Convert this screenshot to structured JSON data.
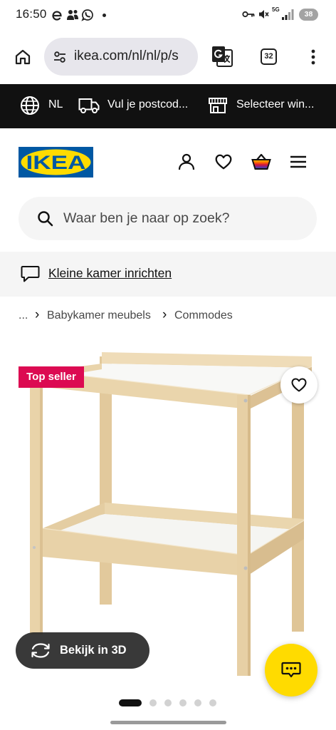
{
  "status_bar": {
    "time": "16:50",
    "network_type": "5G",
    "battery_level": "38",
    "left_icons": [
      "e-icon",
      "people-icon",
      "whatsapp-icon",
      "notification-dot-icon"
    ],
    "right_icons": [
      "key-icon",
      "mute-icon",
      "signal-icon",
      "battery-icon"
    ]
  },
  "browser": {
    "url": "ikea.com/nl/nl/p/s",
    "tab_count": "32",
    "icons": [
      "home-icon",
      "tune-icon",
      "google-translate-icon",
      "more-vert-icon"
    ]
  },
  "utility_bar": {
    "language": {
      "icon": "globe-icon",
      "label": "NL"
    },
    "postcode": {
      "icon": "truck-icon",
      "label": "Vul je postcod..."
    },
    "store": {
      "icon": "store-icon",
      "label": "Selecteer win..."
    }
  },
  "header": {
    "logo_text": "IKEA",
    "icons": [
      "person-icon",
      "heart-icon",
      "basket-icon",
      "menu-icon"
    ]
  },
  "search": {
    "icon": "search-icon",
    "placeholder": "Waar ben je naar op zoek?"
  },
  "promo": {
    "icon": "chat-bubble-icon",
    "link_text": "Kleine kamer inrichten"
  },
  "breadcrumb": {
    "items": [
      "...",
      "Babykamer meubels",
      "Commodes"
    ],
    "separator": "›"
  },
  "product": {
    "badge": "Top seller",
    "favourite_icon": "heart-icon",
    "view_3d": {
      "icon": "rotate-3d-icon",
      "label": "Bekijk in 3D"
    },
    "carousel": {
      "slides": 6,
      "active": 1
    }
  },
  "chat_button": {
    "icon": "chat-icon"
  },
  "colors": {
    "ikea_blue": "#0058a3",
    "ikea_yellow": "#ffdb00",
    "badge_red": "#dc0a52",
    "utility_bar_bg": "#111111",
    "surface_gray": "#f5f5f5",
    "chat_button": "#ffdb00"
  }
}
